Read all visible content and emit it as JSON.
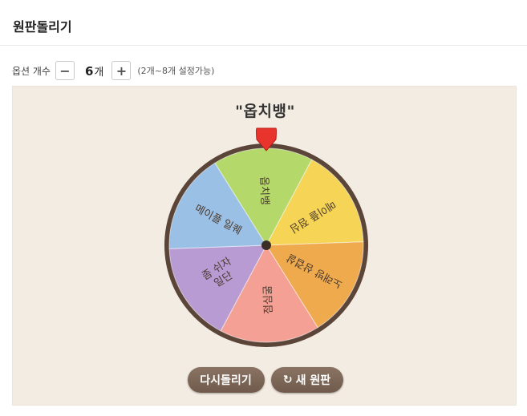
{
  "header": {
    "title": "원판돌리기"
  },
  "options": {
    "label": "옵션 개수",
    "minus_symbol": "−",
    "plus_symbol": "+",
    "count_value": "6",
    "count_unit": "개",
    "range_note": "(2개~8개 설정가능)"
  },
  "wheel": {
    "result": "\"옵치뱅\"",
    "rim_color": "#5b4438",
    "pointer_color": "#e8342c",
    "segments": [
      {
        "label": "옵치뱅",
        "color": "#b4d96a"
      },
      {
        "label": "메이플 점심",
        "color": "#f6d456"
      },
      {
        "label": "노래방 삼겹살",
        "color": "#efaa4e"
      },
      {
        "label": "점심굶",
        "color": "#f4a095"
      },
      {
        "label": "좀 쉬자 일단",
        "color": "#b99bd4"
      },
      {
        "label": "메이플 일퀘",
        "color": "#9bc0e6"
      }
    ]
  },
  "actions": {
    "spin_again": "다시돌리기",
    "new_wheel": "새 원판",
    "new_wheel_icon": "refresh-icon"
  }
}
